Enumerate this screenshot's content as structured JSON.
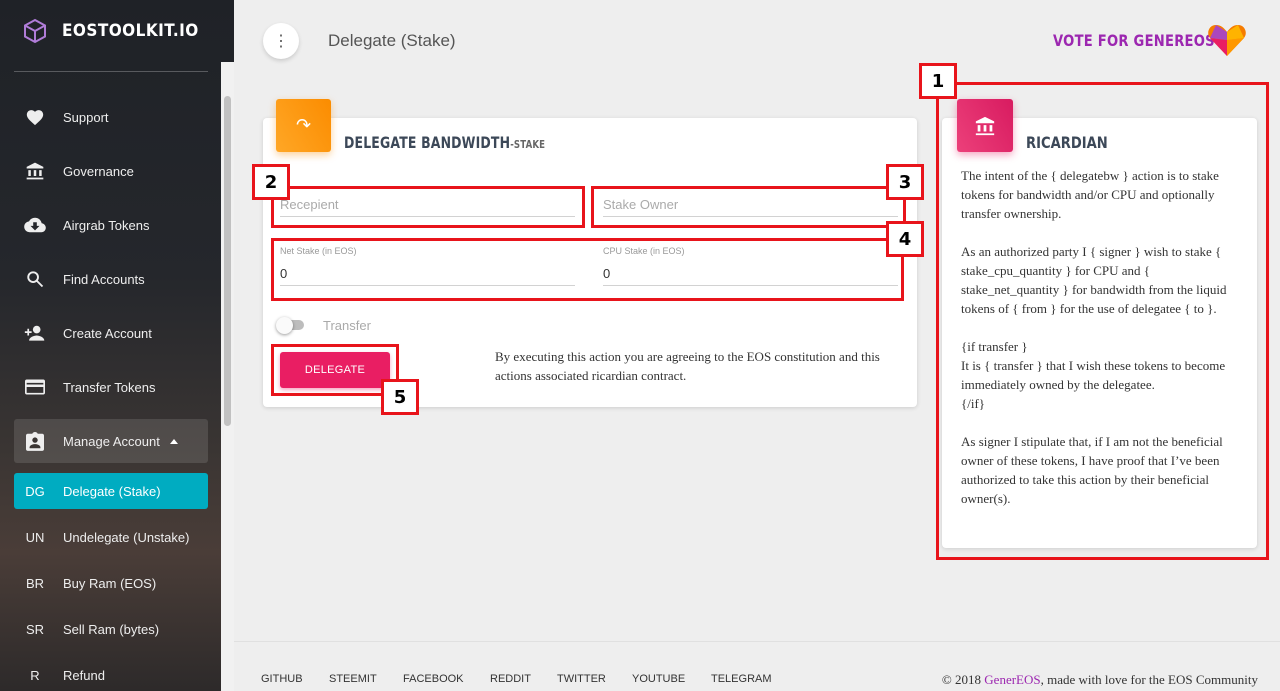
{
  "app": {
    "brand": "EOSTOOLKIT.IO"
  },
  "sidebar": {
    "items": [
      {
        "label": "Support",
        "icon": "heart-icon"
      },
      {
        "label": "Governance",
        "icon": "bank-icon"
      },
      {
        "label": "Airgrab Tokens",
        "icon": "cloud-download-icon"
      },
      {
        "label": "Find Accounts",
        "icon": "search-icon"
      },
      {
        "label": "Create Account",
        "icon": "person-add-icon"
      },
      {
        "label": "Transfer Tokens",
        "icon": "credit-card-icon"
      },
      {
        "label": "Manage Account",
        "icon": "assignment-ind-icon"
      }
    ],
    "subitems": [
      {
        "abbr": "DG",
        "label": "Delegate (Stake)"
      },
      {
        "abbr": "UN",
        "label": "Undelegate (Unstake)"
      },
      {
        "abbr": "BR",
        "label": "Buy Ram (EOS)"
      },
      {
        "abbr": "SR",
        "label": "Sell Ram (bytes)"
      },
      {
        "abbr": "R",
        "label": "Refund"
      }
    ]
  },
  "header": {
    "menu_icon": "more-vert-icon",
    "title": "Delegate (Stake)",
    "vote_link": "VOTE FOR GENEREOS"
  },
  "delegate": {
    "title": "DELEGATE BANDWIDTH",
    "subtitle": "-STAKE",
    "recipient_placeholder": "Recepient",
    "stake_owner_placeholder": "Stake Owner",
    "net_stake_label": "Net Stake (in EOS)",
    "net_stake_value": "0",
    "cpu_stake_label": "CPU Stake (in EOS)",
    "cpu_stake_value": "0",
    "transfer_label": "Transfer",
    "transfer_on": false,
    "button": "DELEGATE",
    "agreement": "By executing this action you are agreeing to the EOS constitution and this actions associated ricardian contract."
  },
  "ricardian": {
    "title": "RICARDIAN",
    "p1": "The intent of the { delegatebw } action is to stake tokens for bandwidth and/or CPU and optionally transfer ownership.",
    "p2": "As an authorized party I { signer } wish to stake { stake_cpu_quantity } for CPU and { stake_net_quantity } for bandwidth from the liquid tokens of { from } for the use of delegatee { to }.",
    "p3a": "{if transfer }",
    "p3b": "It is { transfer } that I wish these tokens to become immediately owned by the delegatee.",
    "p3c": "{/if}",
    "p4": "As signer I stipulate that, if I am not the beneficial owner of these tokens, I have proof that I’ve been authorized to take this action by their beneficial owner(s)."
  },
  "annotations": [
    "1",
    "2",
    "3",
    "4",
    "5"
  ],
  "footer": {
    "links": [
      "GITHUB",
      "STEEMIT",
      "FACEBOOK",
      "REDDIT",
      "TWITTER",
      "YOUTUBE",
      "TELEGRAM"
    ],
    "copy_prefix": "© 2018 ",
    "copy_brand": "GenerEOS",
    "copy_suffix": ", made with love for the EOS Community"
  },
  "colors": {
    "accent_teal": "#00acc1",
    "accent_pink": "#e91e63",
    "accent_orange": "#fb8c00",
    "brand_purple": "#9c27b0",
    "annotation_red": "#e8141b"
  }
}
